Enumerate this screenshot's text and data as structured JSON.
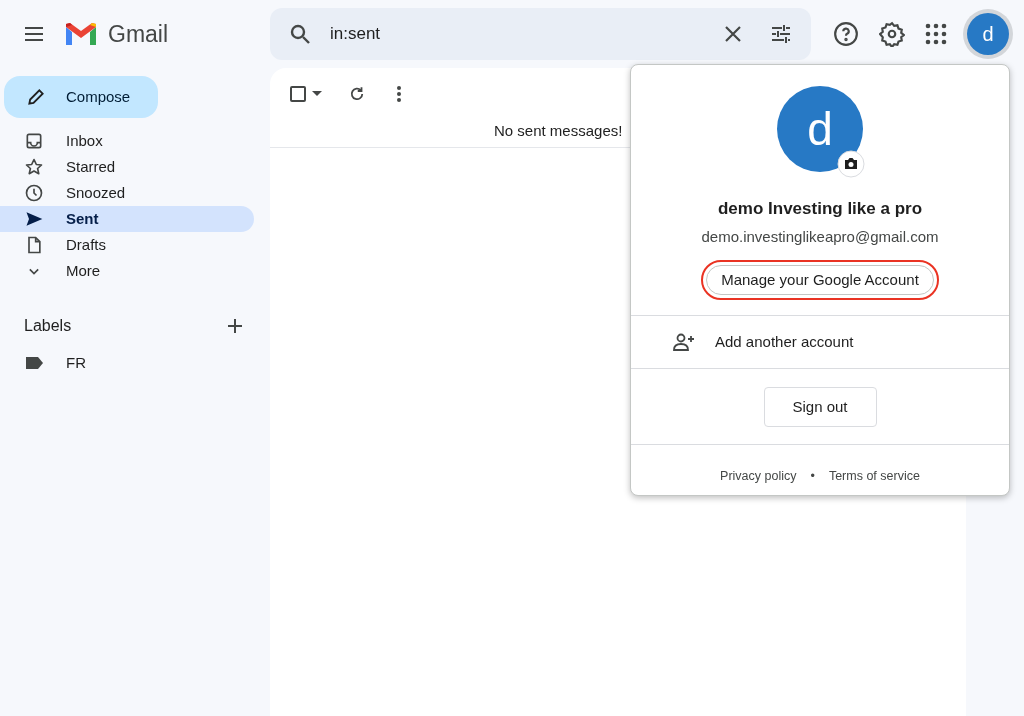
{
  "app": {
    "name": "Gmail"
  },
  "search": {
    "value": "in:sent"
  },
  "account_button": {
    "initial": "d"
  },
  "compose": {
    "label": "Compose"
  },
  "sidebar": {
    "items": [
      {
        "label": "Inbox",
        "kind": "inbox",
        "selected": false
      },
      {
        "label": "Starred",
        "kind": "star",
        "selected": false
      },
      {
        "label": "Snoozed",
        "kind": "clock",
        "selected": false
      },
      {
        "label": "Sent",
        "kind": "send",
        "selected": true
      },
      {
        "label": "Drafts",
        "kind": "file",
        "selected": false
      },
      {
        "label": "More",
        "kind": "chevron",
        "selected": false
      }
    ]
  },
  "labels": {
    "title": "Labels",
    "items": [
      {
        "label": "FR"
      }
    ]
  },
  "message_list": {
    "empty_text": "No sent messages!"
  },
  "account_menu": {
    "initial": "d",
    "name": "demo Investing like a pro",
    "email": "demo.investinglikeapro@gmail.com",
    "manage_button": "Manage your Google Account",
    "highlighted": true,
    "add_account": "Add another account",
    "sign_out": "Sign out",
    "footer_links": [
      "Privacy policy",
      "Terms of service"
    ],
    "separator": "•"
  }
}
